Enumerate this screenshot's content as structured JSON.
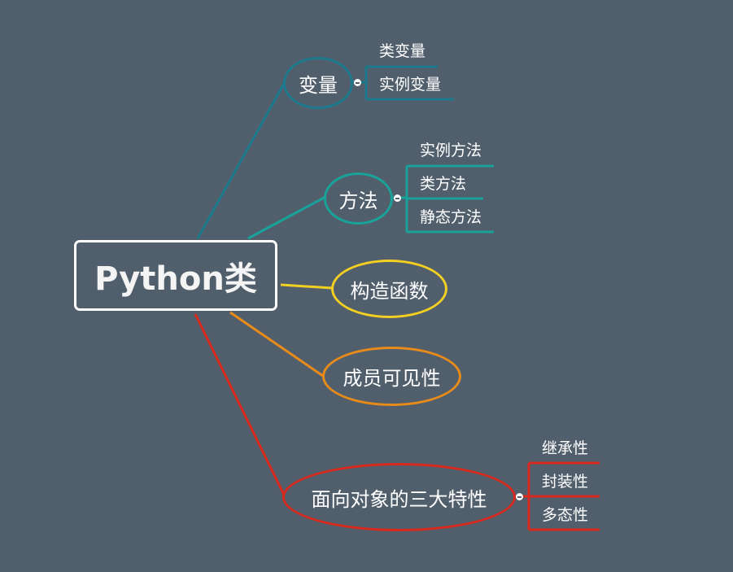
{
  "root": {
    "label": "Python类"
  },
  "branches": [
    {
      "id": "variables",
      "label": "变量",
      "color": "#1c7a8c",
      "children": [
        "类变量",
        "实例变量"
      ]
    },
    {
      "id": "methods",
      "label": "方法",
      "color": "#19a299",
      "children": [
        "实例方法",
        "类方法",
        "静态方法"
      ]
    },
    {
      "id": "constructor",
      "label": "构造函数",
      "color": "#f2cf21",
      "children": []
    },
    {
      "id": "visibility",
      "label": "成员可见性",
      "color": "#e98b18",
      "children": []
    },
    {
      "id": "oop",
      "label": "面向对象的三大特性",
      "color": "#d8291c",
      "children": [
        "继承性",
        "封装性",
        "多态性"
      ]
    }
  ]
}
